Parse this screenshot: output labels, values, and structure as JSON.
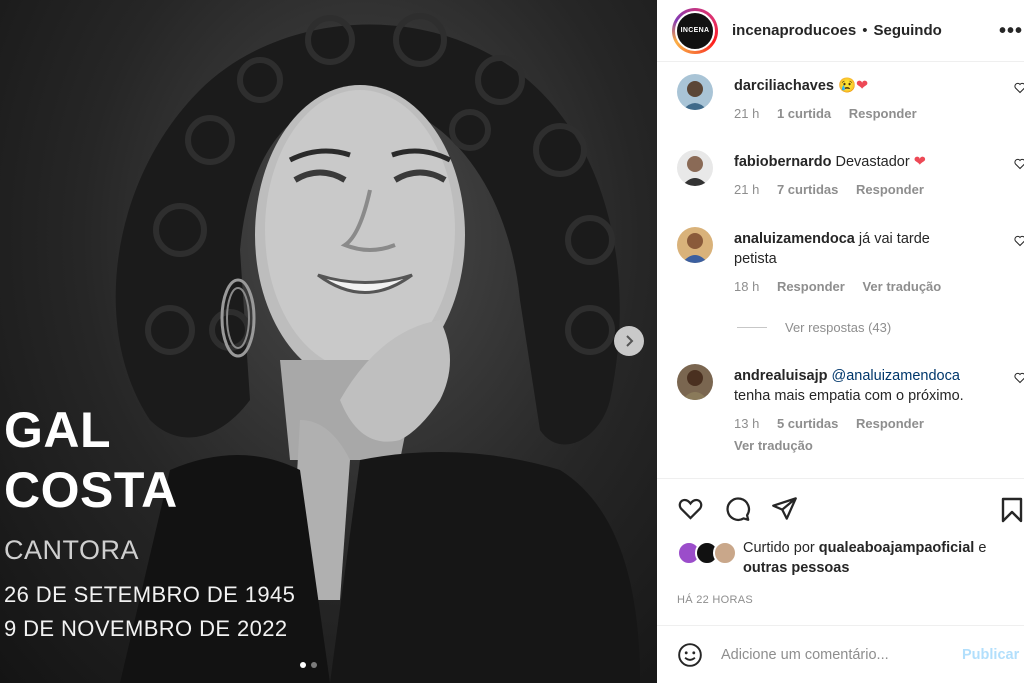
{
  "media": {
    "name_line1": "GAL",
    "name_line2": "COSTA",
    "role": "CANTORA",
    "birth": "26 DE SETEMBRO DE 1945",
    "death": "9 DE NOVEMBRO DE 2022",
    "carousel_count": 2,
    "carousel_active": 1
  },
  "header": {
    "avatar_text": "INCENA",
    "username": "incenaproducoes",
    "separator": "•",
    "follow_status": "Seguindo",
    "more": "•••"
  },
  "comments": [
    {
      "user": "darciliachaves",
      "text": "",
      "emoji": "😢❤",
      "time": "21 h",
      "likes": "1 curtida",
      "reply": "Responder",
      "avatar_color": "#7aa0b8"
    },
    {
      "user": "fabiobernardo",
      "text": "Devastador",
      "emoji": "❤",
      "time": "21 h",
      "likes": "7 curtidas",
      "reply": "Responder",
      "avatar_color": "#6b5546"
    },
    {
      "user": "analuizamendoca",
      "text": "já vai tarde petista",
      "time": "18 h",
      "reply": "Responder",
      "translate": "Ver tradução",
      "avatar_color": "#c49a62"
    },
    {
      "user": "andrealuisajp",
      "mention": "@analuizamendoca",
      "text": "tenha mais empatia com o próximo.",
      "time": "13 h",
      "likes": "5 curtidas",
      "reply": "Responder",
      "translate": "Ver tradução",
      "avatar_color": "#5a4a3a"
    }
  ],
  "replies_link": "Ver respostas (43)",
  "liked": {
    "prefix": "Curtido por",
    "user": "qualeaboajampaoficial",
    "connector": "e",
    "others": "outras pessoas"
  },
  "time_ago": "HÁ 22 HORAS",
  "add_comment": {
    "placeholder": "Adicione um comentário...",
    "post_label": "Publicar"
  },
  "colors": {
    "heart": "#ed4956",
    "mention": "#00376b",
    "muted": "#8e8e8e",
    "post_disabled": "#b2dffc"
  }
}
